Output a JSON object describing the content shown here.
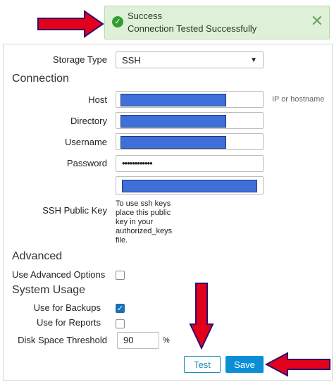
{
  "toast": {
    "title": "Success",
    "message": "Connection Tested Successfully",
    "icon": "check-circle-icon",
    "close_icon": "close-icon",
    "color": "#dff0d8"
  },
  "form": {
    "storage_type": {
      "label": "Storage Type",
      "value": "SSH"
    },
    "connection_title": "Connection",
    "host": {
      "label": "Host",
      "hint": "IP or hostname"
    },
    "directory": {
      "label": "Directory"
    },
    "username": {
      "label": "Username"
    },
    "password": {
      "label": "Password",
      "value": "••••••••••••"
    },
    "ssh_public_key": {
      "label": "SSH Public Key",
      "hint": "To use ssh keys place this public key in your authorized_keys file."
    },
    "advanced_title": "Advanced",
    "use_advanced": {
      "label": "Use Advanced Options",
      "checked": false
    },
    "system_usage_title": "System Usage",
    "use_backups": {
      "label": "Use for Backups",
      "checked": true
    },
    "use_reports": {
      "label": "Use for Reports",
      "checked": false
    },
    "disk_threshold": {
      "label": "Disk Space Threshold",
      "value": "90",
      "unit": "%"
    }
  },
  "buttons": {
    "test": "Test",
    "save": "Save"
  },
  "colors": {
    "accent": "#0a8fd6",
    "arrow": "#e3001b",
    "redaction": "#3f6fd8"
  }
}
